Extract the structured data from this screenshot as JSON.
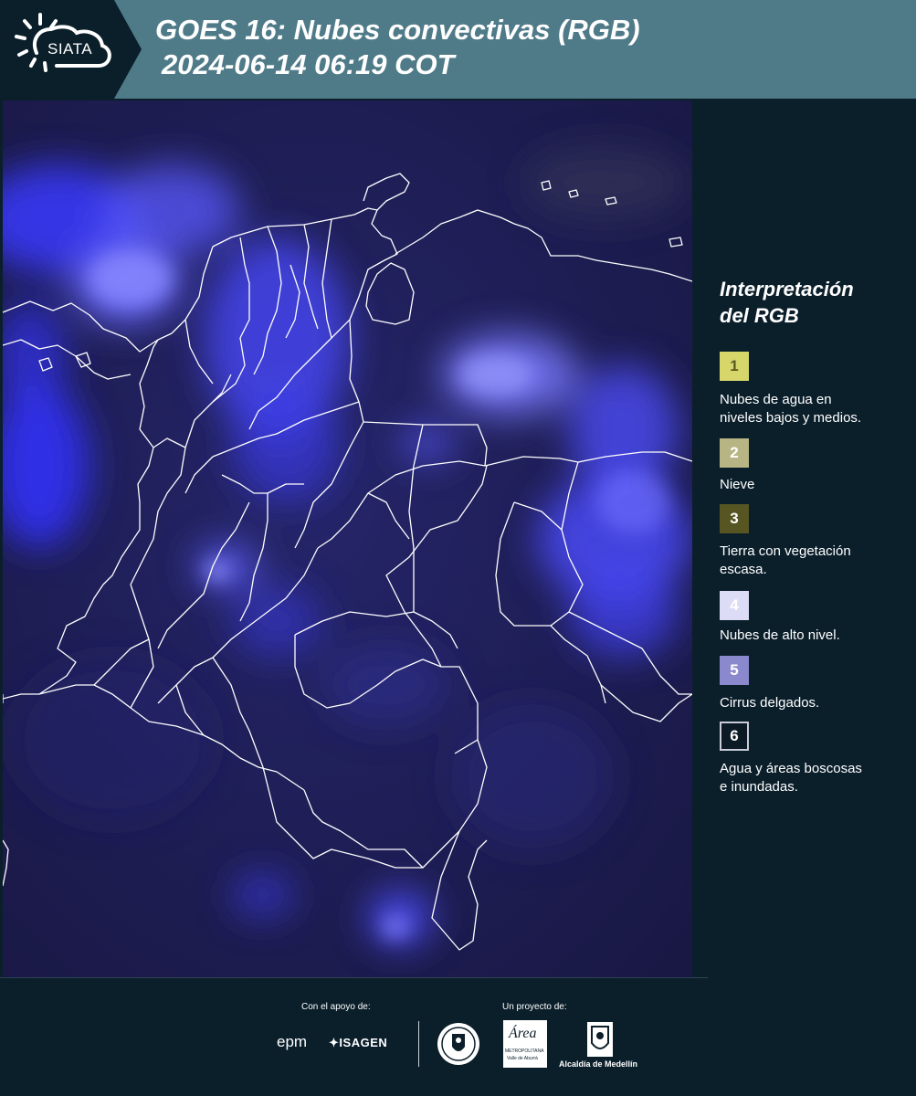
{
  "header": {
    "logo_text": "SIATA",
    "title_line1": "GOES 16: Nubes convectivas (RGB)",
    "title_line2": "2024-06-14 06:19 COT"
  },
  "legend": {
    "title_line1": "Interpretación",
    "title_line2": "del RGB",
    "items": [
      {
        "number": "1",
        "color": "#d7d66b",
        "label_lines": [
          "Nubes de agua en",
          "niveles bajos y medios."
        ]
      },
      {
        "number": "2",
        "color": "#b7b583",
        "label_lines": [
          "Nieve"
        ]
      },
      {
        "number": "3",
        "color": "#575623",
        "label_lines": [
          "Tierra con vegetación",
          "escasa."
        ]
      },
      {
        "number": "4",
        "color": "#dddcf6",
        "label_lines": [
          "Nubes de alto nivel."
        ]
      },
      {
        "number": "5",
        "color": "#8b89cd",
        "label_lines": [
          "Cirrus delgados."
        ]
      },
      {
        "number": "6",
        "color": "#0c1a25",
        "label_lines": [
          "Agua y áreas boscosas",
          "e inundadas."
        ]
      }
    ]
  },
  "footer": {
    "support_label": "Con el apoyo de:",
    "project_label": "Un proyecto de:",
    "sponsors": [
      "epm",
      "ISAGEN"
    ],
    "partners": [
      "Área Metropolitana Valle de Aburrá",
      "Alcaldía de Medellín"
    ],
    "area_logo_word": "Área",
    "area_logo_sub1": "METROPOLITANA",
    "area_logo_sub2": "Valle de Aburrá",
    "alcaldia_label": "Alcaldía de Medellín"
  },
  "colors": {
    "header_bg": "#4f7b89",
    "page_bg": "#0b1f2b",
    "map_base": "#1c1c4e",
    "cloud_blue": "#3b3bff",
    "border_lines": "#ffffff"
  }
}
